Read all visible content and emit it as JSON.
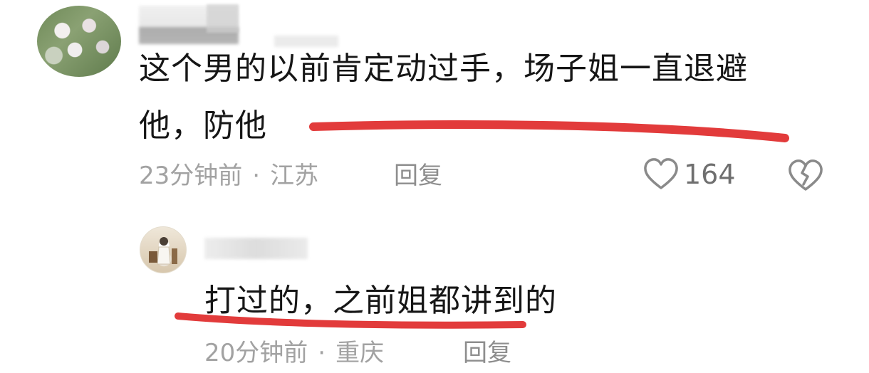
{
  "comments": [
    {
      "text_line1": "这个男的以前肯定动过手，场子姐一直退避",
      "text_line2": "他，防他",
      "time": "23分钟前",
      "separator": "·",
      "location": "江苏",
      "reply_label": "回复",
      "like_count": "164"
    },
    {
      "text": "打过的，之前姐都讲到的",
      "time": "20分钟前",
      "separator": "·",
      "location": "重庆",
      "reply_label": "回复"
    }
  ],
  "colors": {
    "underline": "#e23b3b",
    "text": "#161616",
    "meta": "#a2a2a2"
  },
  "icons": {
    "like": "heart-outline-icon",
    "dislike": "broken-heart-icon"
  }
}
